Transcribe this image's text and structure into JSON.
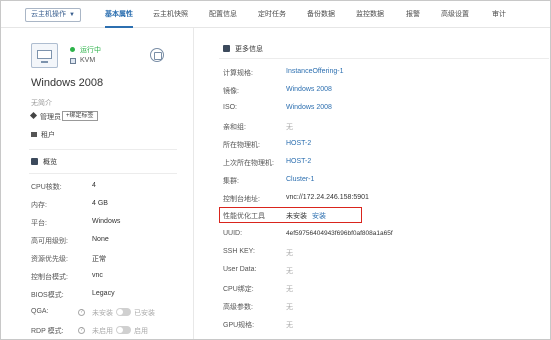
{
  "nav": {
    "ops_label": "云主机操作",
    "tabs": [
      "基本属性",
      "云主机快照",
      "配置信息",
      "定时任务",
      "备份数据",
      "监控数据",
      "报警",
      "高级设置",
      "审计"
    ]
  },
  "vm": {
    "status": "运行中",
    "hypervisor": "KVM",
    "name": "Windows 2008",
    "description": "无简介",
    "owner": "管理员",
    "bind_tag_label": "+绑定标签",
    "tenant": "租户"
  },
  "overview": {
    "title": "概览",
    "rows": [
      {
        "label": "CPU核数:",
        "value": "4"
      },
      {
        "label": "内存:",
        "value": "4 GB"
      },
      {
        "label": "平台:",
        "value": "Windows"
      },
      {
        "label": "高可用级别:",
        "value": "None"
      },
      {
        "label": "资源优先级:",
        "value": "正常"
      },
      {
        "label": "控制台模式:",
        "value": "vnc"
      },
      {
        "label": "BIOS模式:",
        "value": "Legacy"
      }
    ],
    "toggles": [
      {
        "label": "QGA:",
        "left": "未安装",
        "right": "已安装"
      },
      {
        "label": "RDP 模式:",
        "left": "未启用",
        "right": "启用"
      }
    ]
  },
  "more": {
    "title": "更多信息",
    "rows": [
      {
        "label": "计算规格:",
        "value": "InstanceOffering-1",
        "style": "link"
      },
      {
        "label": "镜像:",
        "value": "Windows 2008",
        "style": "link"
      },
      {
        "label": "ISO:",
        "value": "Windows 2008",
        "style": "link"
      },
      {
        "label": "亲和组:",
        "value": "无",
        "style": "muted"
      },
      {
        "label": "所在物理机:",
        "value": "HOST-2",
        "style": "link"
      },
      {
        "label": "上次所在物理机:",
        "value": "HOST-2",
        "style": "link"
      },
      {
        "label": "集群:",
        "value": "Cluster-1",
        "style": "link"
      },
      {
        "label": "控制台地址:",
        "value": "vnc://172.24.246.158:5901",
        "style": "plain"
      },
      {
        "label": "性能优化工具",
        "value": "未安装",
        "style": "plain"
      },
      {
        "label": "UUID:",
        "value": "4ef59756404943f696bf0af808a1a65f",
        "style": "plain"
      },
      {
        "label": "SSH KEY:",
        "value": "无",
        "style": "muted"
      },
      {
        "label": "User Data:",
        "value": "无",
        "style": "muted"
      },
      {
        "label": "CPU绑定:",
        "value": "无",
        "style": "muted"
      },
      {
        "label": "高级参数:",
        "value": "无",
        "style": "muted"
      },
      {
        "label": "GPU规格:",
        "value": "无",
        "style": "muted"
      }
    ],
    "install_label": "安装"
  },
  "colors": {
    "accent": "#2c6fb0",
    "running": "#2db34a",
    "highlight": "#d9251d"
  }
}
